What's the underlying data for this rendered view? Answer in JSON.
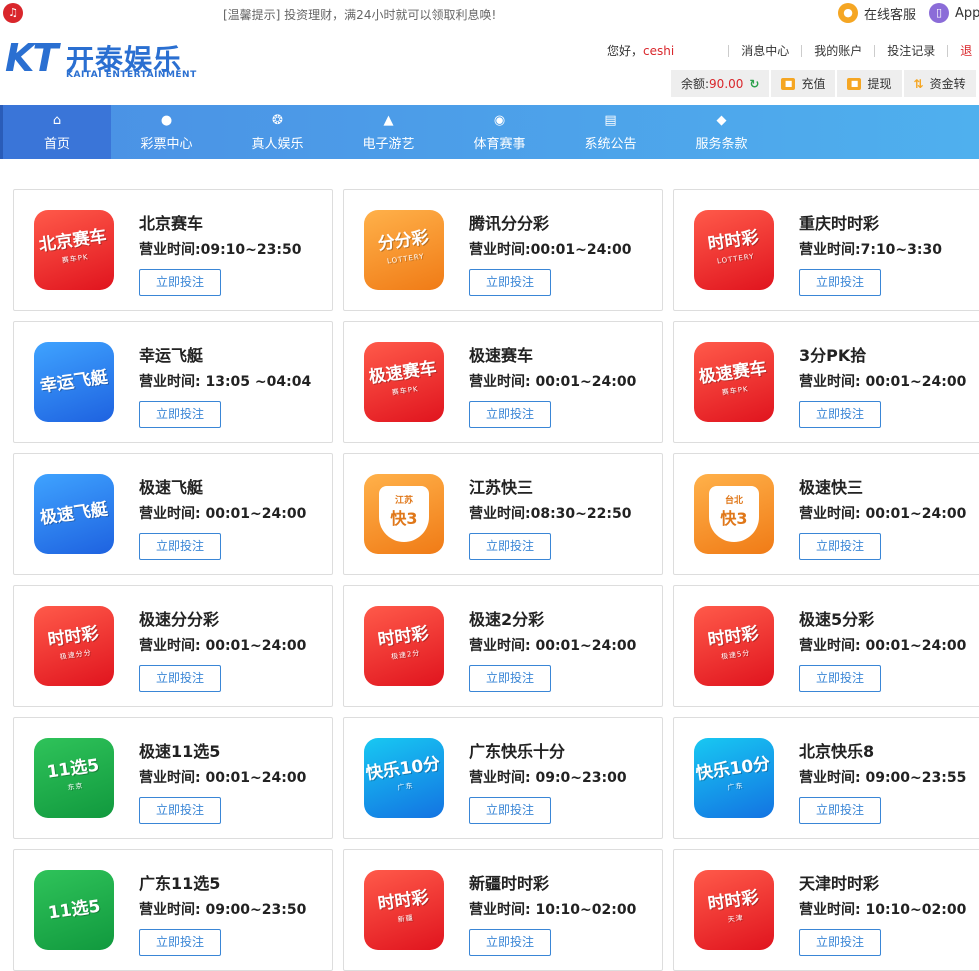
{
  "topbar": {
    "notice": "[温馨提示] 投资理财，满24小时就可以领取利息唤!",
    "service_label": "在线客服",
    "app_label": "App"
  },
  "logo": {
    "mark": "KT",
    "cn": "开泰娱乐",
    "en": "KAITAI ENTERTAINMENT"
  },
  "user": {
    "greeting": "您好，",
    "username": "ceshi",
    "links": [
      "消息中心",
      "我的账户",
      "投注记录"
    ],
    "truncated_link": "退"
  },
  "funds": {
    "balance_label": "余额:",
    "balance": "90.00",
    "deposit": "充值",
    "withdraw": "提现",
    "transfer": "资金转"
  },
  "nav": [
    {
      "label": "首页",
      "icon": "home-icon",
      "active": true
    },
    {
      "label": "彩票中心",
      "icon": "lottery-ball-icon"
    },
    {
      "label": "真人娱乐",
      "icon": "chip-icon"
    },
    {
      "label": "电子游艺",
      "icon": "gamepad-icon"
    },
    {
      "label": "体育赛事",
      "icon": "basketball-icon"
    },
    {
      "label": "系统公告",
      "icon": "notice-icon"
    },
    {
      "label": "服务条款",
      "icon": "diamond-icon"
    }
  ],
  "bet_button_label": "立即投注",
  "games": [
    {
      "name": "北京赛车",
      "hours": "营业时间:09:10~23:50",
      "icon_text": "北京赛车",
      "icon_sub": "赛车PK",
      "color": "red"
    },
    {
      "name": "腾讯分分彩",
      "hours": "营业时间:00:01~24:00",
      "icon_text": "分分彩",
      "icon_sub": "LOTTERY",
      "color": "orange"
    },
    {
      "name": "重庆时时彩",
      "hours": "营业时间:7:10~3:30",
      "icon_text": "时时彩",
      "icon_sub": "LOTTERY",
      "color": "red"
    },
    {
      "name": "幸运飞艇",
      "hours": "营业时间: 13:05 ~04:04",
      "icon_text": "幸运飞艇",
      "icon_sub": "",
      "color": "blue"
    },
    {
      "name": "极速赛车",
      "hours": "营业时间: 00:01~24:00",
      "icon_text": "极速赛车",
      "icon_sub": "赛车PK",
      "color": "red"
    },
    {
      "name": "3分PK拾",
      "hours": "营业时间: 00:01~24:00",
      "icon_text": "极速赛车",
      "icon_sub": "赛车PK",
      "color": "red"
    },
    {
      "name": "极速飞艇",
      "hours": "营业时间: 00:01~24:00",
      "icon_text": "极速飞艇",
      "icon_sub": "",
      "color": "blue"
    },
    {
      "name": "江苏快三",
      "hours": "营业时间:08:30~22:50",
      "icon_text": "快3",
      "icon_sub": "江苏",
      "color": "orange-badge"
    },
    {
      "name": "极速快三",
      "hours": "营业时间: 00:01~24:00",
      "icon_text": "快3",
      "icon_sub": "台北",
      "color": "orange-badge"
    },
    {
      "name": "极速分分彩",
      "hours": "营业时间: 00:01~24:00",
      "icon_text": "时时彩",
      "icon_sub": "极速分分",
      "color": "red"
    },
    {
      "name": "极速2分彩",
      "hours": "营业时间: 00:01~24:00",
      "icon_text": "时时彩",
      "icon_sub": "极速2分",
      "color": "red"
    },
    {
      "name": "极速5分彩",
      "hours": "营业时间: 00:01~24:00",
      "icon_text": "时时彩",
      "icon_sub": "极速5分",
      "color": "red"
    },
    {
      "name": "极速11选5",
      "hours": "营业时间: 00:01~24:00",
      "icon_text": "11选5",
      "icon_sub": "东京",
      "color": "green"
    },
    {
      "name": "广东快乐十分",
      "hours": "营业时间: 09:0~23:00",
      "icon_text": "快乐10分",
      "icon_sub": "广东",
      "color": "cyan"
    },
    {
      "name": "北京快乐8",
      "hours": "营业时间: 09:00~23:55",
      "icon_text": "快乐10分",
      "icon_sub": "广东",
      "color": "cyan"
    },
    {
      "name": "广东11选5",
      "hours": "营业时间: 09:00~23:50",
      "icon_text": "11选5",
      "icon_sub": "",
      "color": "green"
    },
    {
      "name": "新疆时时彩",
      "hours": "营业时间: 10:10~02:00",
      "icon_text": "时时彩",
      "icon_sub": "新疆",
      "color": "red"
    },
    {
      "name": "天津时时彩",
      "hours": "营业时间: 10:10~02:00",
      "icon_text": "时时彩",
      "icon_sub": "天津",
      "color": "red"
    }
  ]
}
